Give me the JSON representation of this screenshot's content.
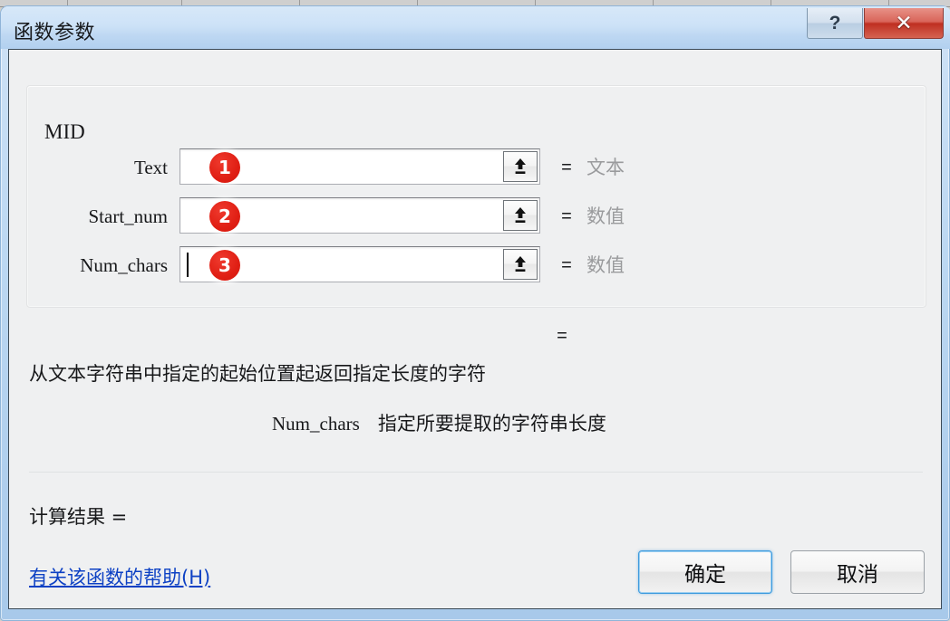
{
  "window": {
    "title": "函数参数",
    "help_button": "?",
    "close_button": "✕"
  },
  "group": {
    "title": "MID"
  },
  "arguments": [
    {
      "label": "Text",
      "value": "",
      "badge": "1",
      "equals": "=",
      "type_hint": "文本",
      "picker_icon": "collapse-dialog-icon",
      "has_caret": false
    },
    {
      "label": "Start_num",
      "value": "",
      "badge": "2",
      "equals": "=",
      "type_hint": "数值",
      "picker_icon": "collapse-dialog-icon",
      "has_caret": false
    },
    {
      "label": "Num_chars",
      "value": "",
      "badge": "3",
      "equals": "=",
      "type_hint": "数值",
      "picker_icon": "collapse-dialog-icon",
      "has_caret": true
    }
  ],
  "result": {
    "equals_sign": "=",
    "function_description": "从文本字符串中指定的起始位置起返回指定长度的字符",
    "argument_name": "Num_chars",
    "argument_description": "指定所要提取的字符串长度",
    "calc_result_label": "计算结果 =",
    "calc_result_value": ""
  },
  "footer": {
    "help_link": "有关该函数的帮助(H)",
    "ok_button": "确定",
    "cancel_button": "取消"
  },
  "colors": {
    "badge_red": "#e01f14",
    "link_blue": "#0d41c4",
    "focus_blue": "#3c9ade",
    "close_red": "#bf2f21",
    "hint_gray": "#9a9b9d"
  }
}
